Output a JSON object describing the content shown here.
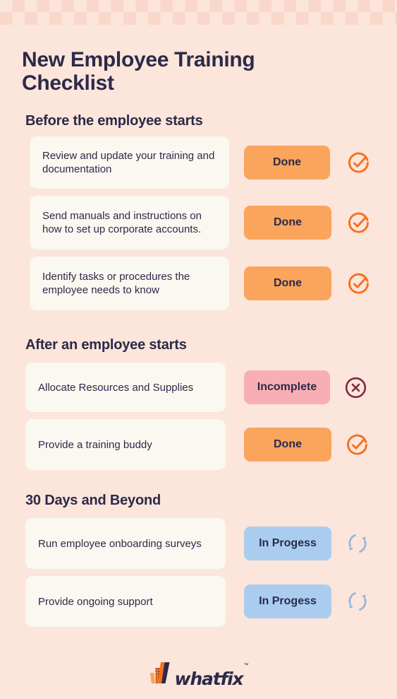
{
  "theme": {
    "background": "#FCE5DA",
    "checker_square": "#FAD7CB",
    "card_bg": "#FAF8F0",
    "text_dark": "#2C2A4A",
    "done_badge": "#FAA45C",
    "done_icon": "#F4701F",
    "incomplete_badge": "#F7AFB5",
    "incomplete_icon": "#7E2B43",
    "progress_badge": "#AACDEF",
    "progress_icon": "#8CB8E4",
    "logo_orange": "#F4701F",
    "logo_orange_light": "#FAA45C"
  },
  "page": {
    "title": "New Employee Training Checklist"
  },
  "sections": [
    {
      "id": "before-start",
      "title": "Before the employee starts",
      "items": [
        {
          "task": "Review and update your training and documentation",
          "status_label": "Done",
          "status": "done",
          "icon": "check-circle-icon"
        },
        {
          "task": "Send manuals and instructions on how to set up corporate accounts.",
          "status_label": "Done",
          "status": "done",
          "icon": "check-circle-icon"
        },
        {
          "task": "Identify tasks or procedures the employee needs to know",
          "status_label": "Done",
          "status": "done",
          "icon": "check-circle-icon"
        }
      ]
    },
    {
      "id": "after-start",
      "title": "After an employee starts",
      "items": [
        {
          "task": "Allocate Resources and Supplies",
          "status_label": "Incomplete",
          "status": "incomplete",
          "icon": "x-circle-icon"
        },
        {
          "task": "Provide a training buddy",
          "status_label": "Done",
          "status": "done",
          "icon": "check-circle-icon"
        }
      ]
    },
    {
      "id": "thirty-days",
      "title": "30 Days and Beyond",
      "items": [
        {
          "task": "Run employee onboarding surveys",
          "status_label": "In Progess",
          "status": "progress",
          "icon": "refresh-circle-icon"
        },
        {
          "task": "Provide ongoing support",
          "status_label": "In Progess",
          "status": "progress",
          "icon": "refresh-circle-icon"
        }
      ]
    }
  ],
  "footer": {
    "logo_text": "whatfix",
    "logo_tm": "™"
  }
}
